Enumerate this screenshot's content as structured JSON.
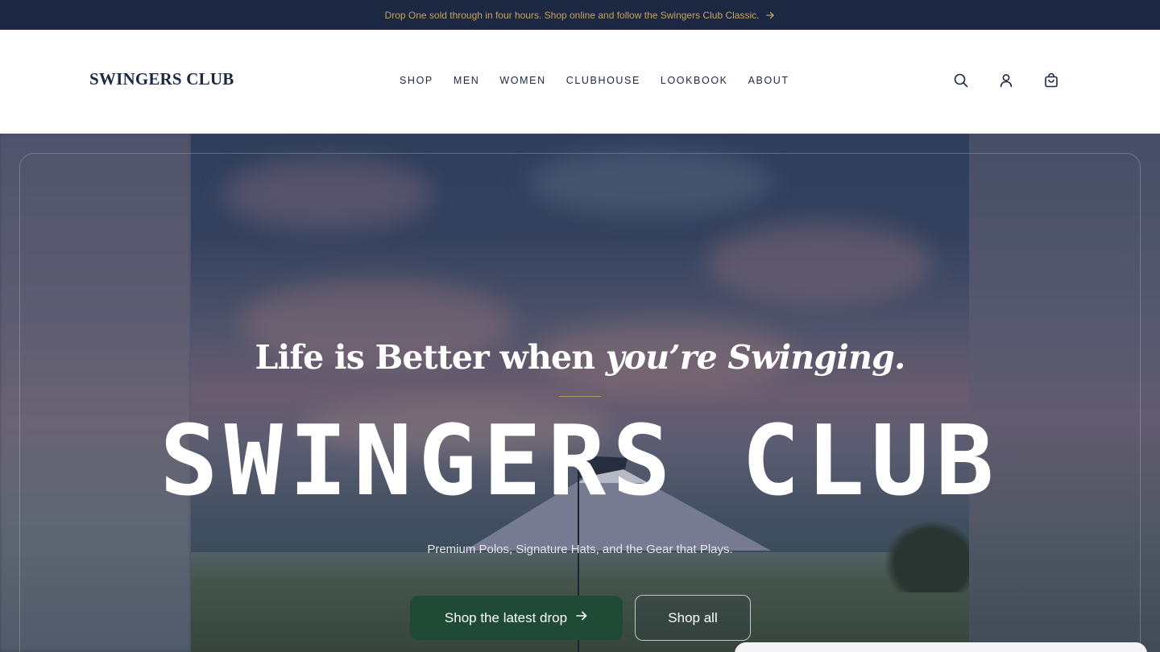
{
  "announcement": {
    "text": "Drop One sold through in four hours. Shop online and follow the Swingers Club Classic.",
    "arrow_icon": "arrow-right-icon"
  },
  "header": {
    "logo": "SWINGERS CLUB",
    "nav": [
      "SHOP",
      "MEN",
      "WOMEN",
      "CLUBHOUSE",
      "LOOKBOOK",
      "ABOUT"
    ],
    "icons": [
      "search-icon",
      "account-icon",
      "cart-icon"
    ]
  },
  "hero": {
    "tagline_plain": "Life is Better when ",
    "tagline_italic": "you’re Swinging.",
    "brand": "SWINGERS CLUB",
    "subtitle": "Premium Polos, Signature Hats, and the Gear that Plays.",
    "primary_button": "Shop the latest drop",
    "secondary_button": "Shop all"
  },
  "colors": {
    "navy": "#1c2841",
    "gold": "#c9a25c",
    "green": "#1f4a35",
    "white": "#ffffff"
  }
}
